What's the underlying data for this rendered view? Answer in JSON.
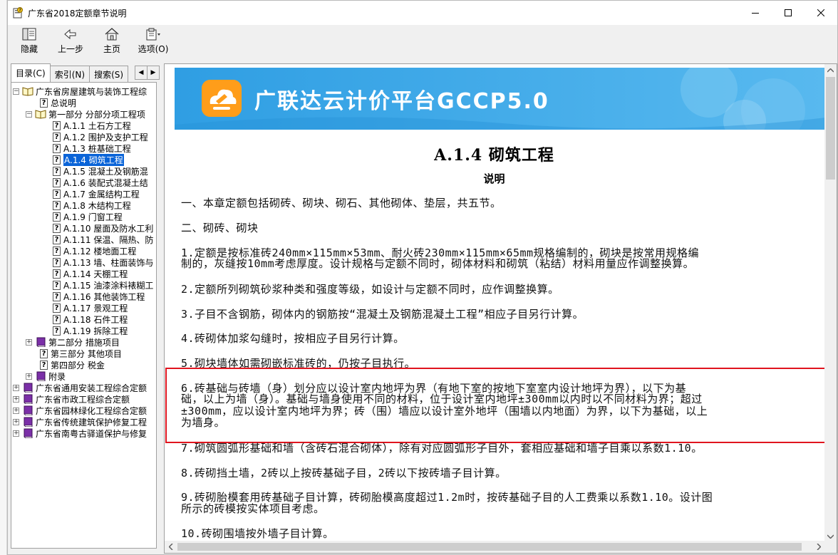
{
  "window": {
    "title": "广东省2018定额章节说明",
    "controls": [
      "minimize-icon",
      "maximize-icon",
      "close-icon"
    ]
  },
  "toolbar": {
    "hide_label": "隐藏",
    "back_label": "上一步",
    "home_label": "主页",
    "options_label": "选项(O)"
  },
  "tabs": {
    "contents": "目录(C)",
    "index": "索引(N)",
    "search": "搜索(S)"
  },
  "tree": {
    "root1": "广东省房屋建筑与装饰工程综",
    "general": "总说明",
    "part1": "第一部分 分部分项工程项",
    "items": [
      {
        "label": "A.1.1 土石方工程",
        "selected": false
      },
      {
        "label": "A.1.2 围护及支护工程",
        "selected": false
      },
      {
        "label": "A.1.3 桩基础工程",
        "selected": false
      },
      {
        "label": "A.1.4 砌筑工程",
        "selected": true
      },
      {
        "label": "A.1.5 混凝土及钢筋混",
        "selected": false
      },
      {
        "label": "A.1.6 装配式混凝土结",
        "selected": false
      },
      {
        "label": "A.1.7 金属结构工程",
        "selected": false
      },
      {
        "label": "A.1.8 木结构工程",
        "selected": false
      },
      {
        "label": "A.1.9 门窗工程",
        "selected": false
      },
      {
        "label": "A.1.10 屋面及防水工利",
        "selected": false
      },
      {
        "label": "A.1.11 保温、隔热、防",
        "selected": false
      },
      {
        "label": "A.1.12 楼地面工程",
        "selected": false
      },
      {
        "label": "A.1.13 墙、柱面装饰与",
        "selected": false
      },
      {
        "label": "A.1.14 天棚工程",
        "selected": false
      },
      {
        "label": "A.1.15 油漆涂料裱糊工",
        "selected": false
      },
      {
        "label": "A.1.16 其他装饰工程",
        "selected": false
      },
      {
        "label": "A.1.17 景观工程",
        "selected": false
      },
      {
        "label": "A.1.18 石件工程",
        "selected": false
      },
      {
        "label": "A.1.19 拆除工程",
        "selected": false
      }
    ],
    "part2": "第二部分 措施项目",
    "part3": "第三部分 其他项目",
    "part4": "第四部分 税金",
    "appendix": "附录",
    "roots": [
      "广东省通用安装工程综合定额",
      "广东省市政工程综合定额",
      "广东省园林绿化工程综合定额",
      "广东省传统建筑保护修复工程",
      "广东省南粤古驿道保护与修复"
    ]
  },
  "content": {
    "banner_text": "广联达云计价平台GCCP5.0",
    "title": "A.1.4 砌筑工程",
    "subtitle": "说明",
    "p1": "一、本章定额包括砌砖、砌块、砌石、其他砌体、垫层，共五节。",
    "p2": "二、砌砖、砌块",
    "p3a": "1.定额是按标准砖240mm×115mm×53mm、耐火砖230mm×115mm×65mm规格编制的，砌块是按常用规格编",
    "p3b": "制的，灰缝按10mm考虑厚度。设计规格与定额不同时，砌体材料和砌筑（粘结）材料用量应作调整换算。",
    "p4": "2.定额所列砌筑砂浆种类和强度等级，如设计与定额不同时，应作调整换算。",
    "p5": "3.子目不含钢筋，砌体内的钢筋按“混凝土及钢筋混凝土工程”相应子目另行计算。",
    "p6": "4.砖砌体加浆勾缝时，按相应子目另行计算。",
    "p7": "5.砌块墙体如需砌嵌标准砖的，仍按子目执行。",
    "p8a": "6.砖基础与砖墙（身）划分应以设计室内地坪为界（有地下室的按地下室室内设计地坪为界），以下为基",
    "p8b": "础，以上为墙（身）。基础与墙身使用不同的材料，位于设计室内地坪±300mm以内时以不同材料为界；超过",
    "p8c": "±300mm，应以设计室内地坪为界；砖（围）墙应以设计室外地坪（围墙以内地面）为界，以下为基础，以上",
    "p8d": "为墙身。",
    "p9": "7.砌筑圆弧形基础和墙（含砖石混合砌体），除有对应圆弧形子目外，套相应基础和墙子目乘以系数1.10。",
    "p10": "8.砖砌挡土墙，2砖以上按砖基础子目，2砖以下按砖墙子目计算。",
    "p11a": "9.砖砌胎模套用砖基础子目计算，砖砌胎模高度超过1.2m时，按砖基础子目的人工费乘以系数1.10。设计图",
    "p11b": "所示的砖模按实体项目考虑。",
    "p12": "10.砖砌围墙按外墙子目计算。"
  },
  "colors": {
    "banner": "#3aa6e6",
    "highlight": "#e0141e",
    "selection": "#0a64d8"
  }
}
